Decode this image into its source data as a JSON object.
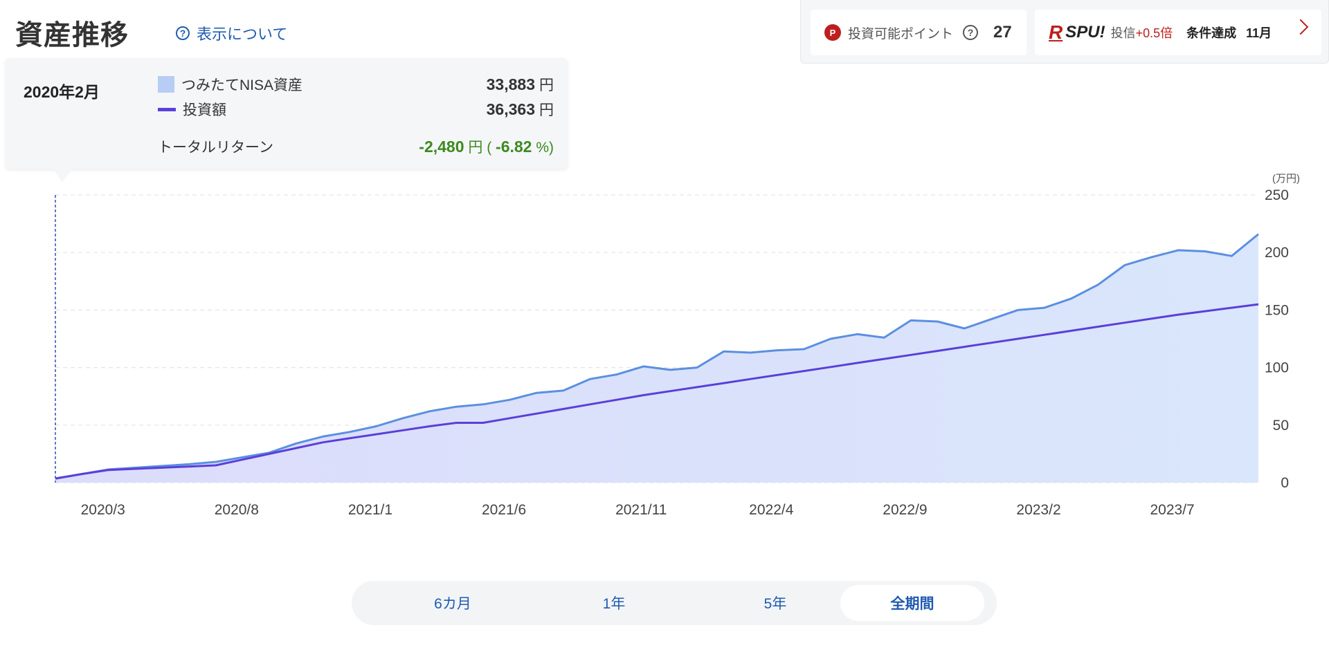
{
  "header": {
    "title": "資産推移",
    "about_label": "表示について"
  },
  "points": {
    "badge": "P",
    "label": "投資可能ポイント",
    "help": "?",
    "value": "27"
  },
  "spu": {
    "r_mark": "R",
    "logo": "SPU!",
    "label": "投信",
    "boost": "+0.5倍",
    "condition": "条件達成",
    "month": "11月"
  },
  "tooltip": {
    "date": "2020年2月",
    "asset_label": "つみたてNISA資産",
    "asset_value": "33,883",
    "asset_unit": "円",
    "invest_label": "投資額",
    "invest_value": "36,363",
    "invest_unit": "円",
    "return_label": "トータルリターン",
    "return_value": "-2,480",
    "return_unit": "円",
    "return_pct_open": "(",
    "return_pct": "-6.82",
    "return_pct_close": "%)"
  },
  "period": {
    "options": [
      "6カ月",
      "1年",
      "5年",
      "全期間"
    ],
    "selected": "全期間"
  },
  "colors": {
    "area_fill": "#d9e4fb",
    "asset_line": "#5b8fe0",
    "invest_line": "#5a3fd9",
    "positive": "#3b8a1f",
    "link": "#1f5bb0"
  },
  "chart_data": {
    "type": "area",
    "y_unit": "(万円)",
    "ylim": [
      0,
      250
    ],
    "yticks": [
      0,
      50,
      100,
      150,
      200,
      250
    ],
    "grid": true,
    "legend": "tooltip top-left",
    "x_ticks": [
      "2020/3",
      "2020/8",
      "2021/1",
      "2021/6",
      "2021/11",
      "2022/4",
      "2022/9",
      "2023/2",
      "2023/7"
    ],
    "x": [
      "2020/2",
      "2020/3",
      "2020/4",
      "2020/5",
      "2020/6",
      "2020/7",
      "2020/8",
      "2020/9",
      "2020/10",
      "2020/11",
      "2020/12",
      "2021/1",
      "2021/2",
      "2021/3",
      "2021/4",
      "2021/5",
      "2021/6",
      "2021/7",
      "2021/8",
      "2021/9",
      "2021/10",
      "2021/11",
      "2021/12",
      "2022/1",
      "2022/2",
      "2022/3",
      "2022/4",
      "2022/5",
      "2022/6",
      "2022/7",
      "2022/8",
      "2022/9",
      "2022/10",
      "2022/11",
      "2022/12",
      "2023/1",
      "2023/2",
      "2023/3",
      "2023/4",
      "2023/5",
      "2023/6",
      "2023/7",
      "2023/8",
      "2023/9",
      "2023/10",
      "2023/11"
    ],
    "series": [
      {
        "name": "つみたてNISA資産",
        "values": [
          3.4,
          7.5,
          11.5,
          13,
          14.5,
          16,
          18,
          22,
          26,
          34,
          40,
          44,
          49,
          56,
          62,
          66,
          68,
          72,
          78,
          80,
          90,
          94,
          101,
          98,
          100,
          114,
          113,
          115,
          116,
          125,
          129,
          126,
          141,
          140,
          134,
          142,
          150,
          152,
          160,
          172,
          189,
          196,
          202,
          201,
          197,
          216
        ]
      },
      {
        "name": "投資額",
        "values": [
          3.6,
          7.5,
          11,
          12,
          13,
          14,
          15,
          20,
          25,
          30,
          35,
          38.5,
          42,
          45.5,
          49,
          52,
          52,
          56,
          60,
          64,
          68,
          72,
          76,
          79.5,
          83,
          86.5,
          90,
          93.5,
          97,
          100.5,
          104,
          107.5,
          111,
          114.5,
          118,
          121.5,
          125,
          128.5,
          132,
          135.5,
          139,
          142.5,
          146,
          149,
          152,
          155
        ]
      }
    ]
  }
}
